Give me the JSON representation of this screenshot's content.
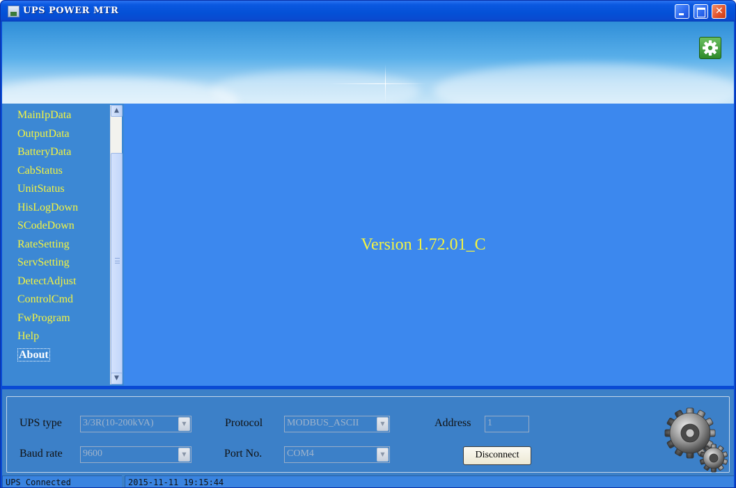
{
  "window": {
    "title": "UPS POWER MTR"
  },
  "sidebar": {
    "items": [
      {
        "label": "MainIpData",
        "active": false
      },
      {
        "label": "OutputData",
        "active": false
      },
      {
        "label": "BatteryData",
        "active": false
      },
      {
        "label": "CabStatus",
        "active": false
      },
      {
        "label": "UnitStatus",
        "active": false
      },
      {
        "label": "HisLogDown",
        "active": false
      },
      {
        "label": "SCodeDown",
        "active": false
      },
      {
        "label": "RateSetting",
        "active": false
      },
      {
        "label": "ServSetting",
        "active": false
      },
      {
        "label": "DetectAdjust",
        "active": false
      },
      {
        "label": "ControlCmd",
        "active": false
      },
      {
        "label": "FwProgram",
        "active": false
      },
      {
        "label": "Help",
        "active": false
      },
      {
        "label": "About",
        "active": true
      }
    ]
  },
  "main": {
    "version_text": "Version 1.72.01_C"
  },
  "controls": {
    "ups_type_label": "UPS type",
    "ups_type_value": "3/3R(10-200kVA)",
    "baud_rate_label": "Baud rate",
    "baud_rate_value": "9600",
    "protocol_label": "Protocol",
    "protocol_value": "MODBUS_ASCII",
    "port_label": "Port No.",
    "port_value": "COM4",
    "address_label": "Address",
    "address_value": "1",
    "disconnect_label": "Disconnect"
  },
  "status": {
    "connection": "UPS Connected",
    "timestamp": "2015-11-11 19:15:44"
  },
  "colors": {
    "nav_text": "#f4f440",
    "main_bg": "#3c88ee",
    "panel_bg": "#3c80c8",
    "title_bar": "#0a4ad4"
  },
  "icons": {
    "settings": "gear-icon",
    "decoration": "gears-icon"
  }
}
